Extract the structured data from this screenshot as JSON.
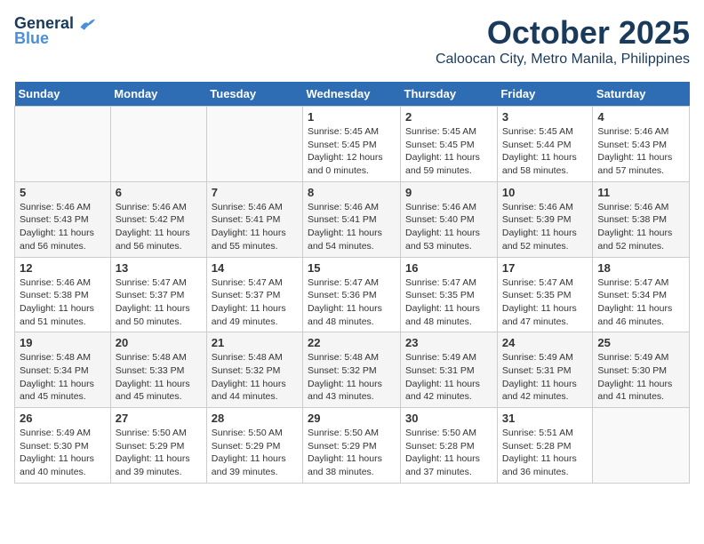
{
  "header": {
    "logo_line1": "General",
    "logo_line2": "Blue",
    "month": "October 2025",
    "location": "Caloocan City, Metro Manila, Philippines"
  },
  "days_of_week": [
    "Sunday",
    "Monday",
    "Tuesday",
    "Wednesday",
    "Thursday",
    "Friday",
    "Saturday"
  ],
  "weeks": [
    [
      {
        "day": "",
        "info": ""
      },
      {
        "day": "",
        "info": ""
      },
      {
        "day": "",
        "info": ""
      },
      {
        "day": "1",
        "info": "Sunrise: 5:45 AM\nSunset: 5:45 PM\nDaylight: 12 hours\nand 0 minutes."
      },
      {
        "day": "2",
        "info": "Sunrise: 5:45 AM\nSunset: 5:45 PM\nDaylight: 11 hours\nand 59 minutes."
      },
      {
        "day": "3",
        "info": "Sunrise: 5:45 AM\nSunset: 5:44 PM\nDaylight: 11 hours\nand 58 minutes."
      },
      {
        "day": "4",
        "info": "Sunrise: 5:46 AM\nSunset: 5:43 PM\nDaylight: 11 hours\nand 57 minutes."
      }
    ],
    [
      {
        "day": "5",
        "info": "Sunrise: 5:46 AM\nSunset: 5:43 PM\nDaylight: 11 hours\nand 56 minutes."
      },
      {
        "day": "6",
        "info": "Sunrise: 5:46 AM\nSunset: 5:42 PM\nDaylight: 11 hours\nand 56 minutes."
      },
      {
        "day": "7",
        "info": "Sunrise: 5:46 AM\nSunset: 5:41 PM\nDaylight: 11 hours\nand 55 minutes."
      },
      {
        "day": "8",
        "info": "Sunrise: 5:46 AM\nSunset: 5:41 PM\nDaylight: 11 hours\nand 54 minutes."
      },
      {
        "day": "9",
        "info": "Sunrise: 5:46 AM\nSunset: 5:40 PM\nDaylight: 11 hours\nand 53 minutes."
      },
      {
        "day": "10",
        "info": "Sunrise: 5:46 AM\nSunset: 5:39 PM\nDaylight: 11 hours\nand 52 minutes."
      },
      {
        "day": "11",
        "info": "Sunrise: 5:46 AM\nSunset: 5:38 PM\nDaylight: 11 hours\nand 52 minutes."
      }
    ],
    [
      {
        "day": "12",
        "info": "Sunrise: 5:46 AM\nSunset: 5:38 PM\nDaylight: 11 hours\nand 51 minutes."
      },
      {
        "day": "13",
        "info": "Sunrise: 5:47 AM\nSunset: 5:37 PM\nDaylight: 11 hours\nand 50 minutes."
      },
      {
        "day": "14",
        "info": "Sunrise: 5:47 AM\nSunset: 5:37 PM\nDaylight: 11 hours\nand 49 minutes."
      },
      {
        "day": "15",
        "info": "Sunrise: 5:47 AM\nSunset: 5:36 PM\nDaylight: 11 hours\nand 48 minutes."
      },
      {
        "day": "16",
        "info": "Sunrise: 5:47 AM\nSunset: 5:35 PM\nDaylight: 11 hours\nand 48 minutes."
      },
      {
        "day": "17",
        "info": "Sunrise: 5:47 AM\nSunset: 5:35 PM\nDaylight: 11 hours\nand 47 minutes."
      },
      {
        "day": "18",
        "info": "Sunrise: 5:47 AM\nSunset: 5:34 PM\nDaylight: 11 hours\nand 46 minutes."
      }
    ],
    [
      {
        "day": "19",
        "info": "Sunrise: 5:48 AM\nSunset: 5:34 PM\nDaylight: 11 hours\nand 45 minutes."
      },
      {
        "day": "20",
        "info": "Sunrise: 5:48 AM\nSunset: 5:33 PM\nDaylight: 11 hours\nand 45 minutes."
      },
      {
        "day": "21",
        "info": "Sunrise: 5:48 AM\nSunset: 5:32 PM\nDaylight: 11 hours\nand 44 minutes."
      },
      {
        "day": "22",
        "info": "Sunrise: 5:48 AM\nSunset: 5:32 PM\nDaylight: 11 hours\nand 43 minutes."
      },
      {
        "day": "23",
        "info": "Sunrise: 5:49 AM\nSunset: 5:31 PM\nDaylight: 11 hours\nand 42 minutes."
      },
      {
        "day": "24",
        "info": "Sunrise: 5:49 AM\nSunset: 5:31 PM\nDaylight: 11 hours\nand 42 minutes."
      },
      {
        "day": "25",
        "info": "Sunrise: 5:49 AM\nSunset: 5:30 PM\nDaylight: 11 hours\nand 41 minutes."
      }
    ],
    [
      {
        "day": "26",
        "info": "Sunrise: 5:49 AM\nSunset: 5:30 PM\nDaylight: 11 hours\nand 40 minutes."
      },
      {
        "day": "27",
        "info": "Sunrise: 5:50 AM\nSunset: 5:29 PM\nDaylight: 11 hours\nand 39 minutes."
      },
      {
        "day": "28",
        "info": "Sunrise: 5:50 AM\nSunset: 5:29 PM\nDaylight: 11 hours\nand 39 minutes."
      },
      {
        "day": "29",
        "info": "Sunrise: 5:50 AM\nSunset: 5:29 PM\nDaylight: 11 hours\nand 38 minutes."
      },
      {
        "day": "30",
        "info": "Sunrise: 5:50 AM\nSunset: 5:28 PM\nDaylight: 11 hours\nand 37 minutes."
      },
      {
        "day": "31",
        "info": "Sunrise: 5:51 AM\nSunset: 5:28 PM\nDaylight: 11 hours\nand 36 minutes."
      },
      {
        "day": "",
        "info": ""
      }
    ]
  ]
}
